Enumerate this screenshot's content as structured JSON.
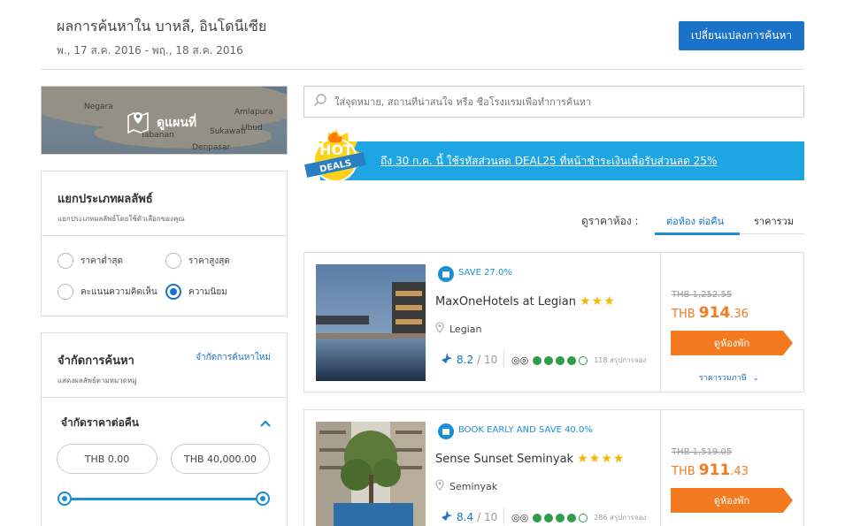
{
  "header": {
    "title": "ผลการค้นหาใน บาหลี, อินโดนีเซีย",
    "dates": "พ., 17 ส.ค. 2016 - พฤ., 18 ส.ค. 2016",
    "change_button": "เปลี่ยนแปลงการค้นหา"
  },
  "map": {
    "cta_label": "ดูแผนที่",
    "places": [
      "Negara",
      "Amlapura",
      "Sukawati",
      "Denpasar",
      "Tabanan",
      "Ubud"
    ]
  },
  "filter_type": {
    "title": "แยกประเภทผลลัพธ์",
    "subtitle": "แยกประเภทผลลัพธ์โดยใช้ตัวเลือกของคุณ",
    "options": [
      {
        "label": "ราคาต่ำสุด",
        "selected": false
      },
      {
        "label": "ราคาสูงสุด",
        "selected": false
      },
      {
        "label": "คะแนนความคิดเห็น",
        "selected": false
      },
      {
        "label": "ความนิยม",
        "selected": true
      }
    ]
  },
  "limit_search": {
    "title": "จำกัดการค้นหา",
    "subtitle": "แสดงผลลัพธ์ตามหมวดหมู่",
    "reset_link": "จำกัดการค้นหาใหม่",
    "price_title": "จำกัดราคาต่อคืน",
    "price_min": "THB 0.00",
    "price_max": "THB 40,000.00"
  },
  "search": {
    "placeholder": "ใส่จุดหมาย, สถานที่น่าสนใจ หรือ ชื่อโรงแรมเพื่อทำการค้นหา"
  },
  "deals": {
    "badge_top": "HOT",
    "badge_bottom": "DEALS",
    "text": "ถึง 30 ก.ค. นี้ ใช้รหัสส่วนลด DEAL25 ที่หน้าชำระเงินเพื่อรับส่วนลด 25%"
  },
  "sort": {
    "label": "ดูราคาห้อง :",
    "tabs": [
      {
        "label": "ต่อห้อง ต่อคืน",
        "active": true
      },
      {
        "label": "ราคารวม",
        "active": false
      }
    ]
  },
  "hotels": [
    {
      "promo": "SAVE 27.0%",
      "name": "MaxOneHotels at Legian",
      "stars": "★★★",
      "location": "Legian",
      "score": "8.2",
      "score_max": "/ 10",
      "reviews": "118 สรุปการจอง",
      "old_price": "THB 1,252.55",
      "currency": "THB",
      "price_main": "914",
      "price_dec": ".36",
      "book_label": "ดูห้องพัก",
      "total_link": "ราคารวมภาษี"
    },
    {
      "promo": "BOOK EARLY AND SAVE 40.0%",
      "name": "Sense Sunset Seminyak",
      "stars": "★★★★",
      "location": "Seminyak",
      "score": "8.4",
      "score_max": "/ 10",
      "reviews": "286 สรุปการจอง",
      "old_price": "THB 1,519.05",
      "currency": "THB",
      "price_main": "911",
      "price_dec": ".43",
      "book_label": "ดูห้องพัก"
    }
  ],
  "colors": {
    "accent_blue": "#1a73c9",
    "banner_blue": "#1ea5e4",
    "orange": "#f47a1f",
    "star": "#f5b800"
  }
}
